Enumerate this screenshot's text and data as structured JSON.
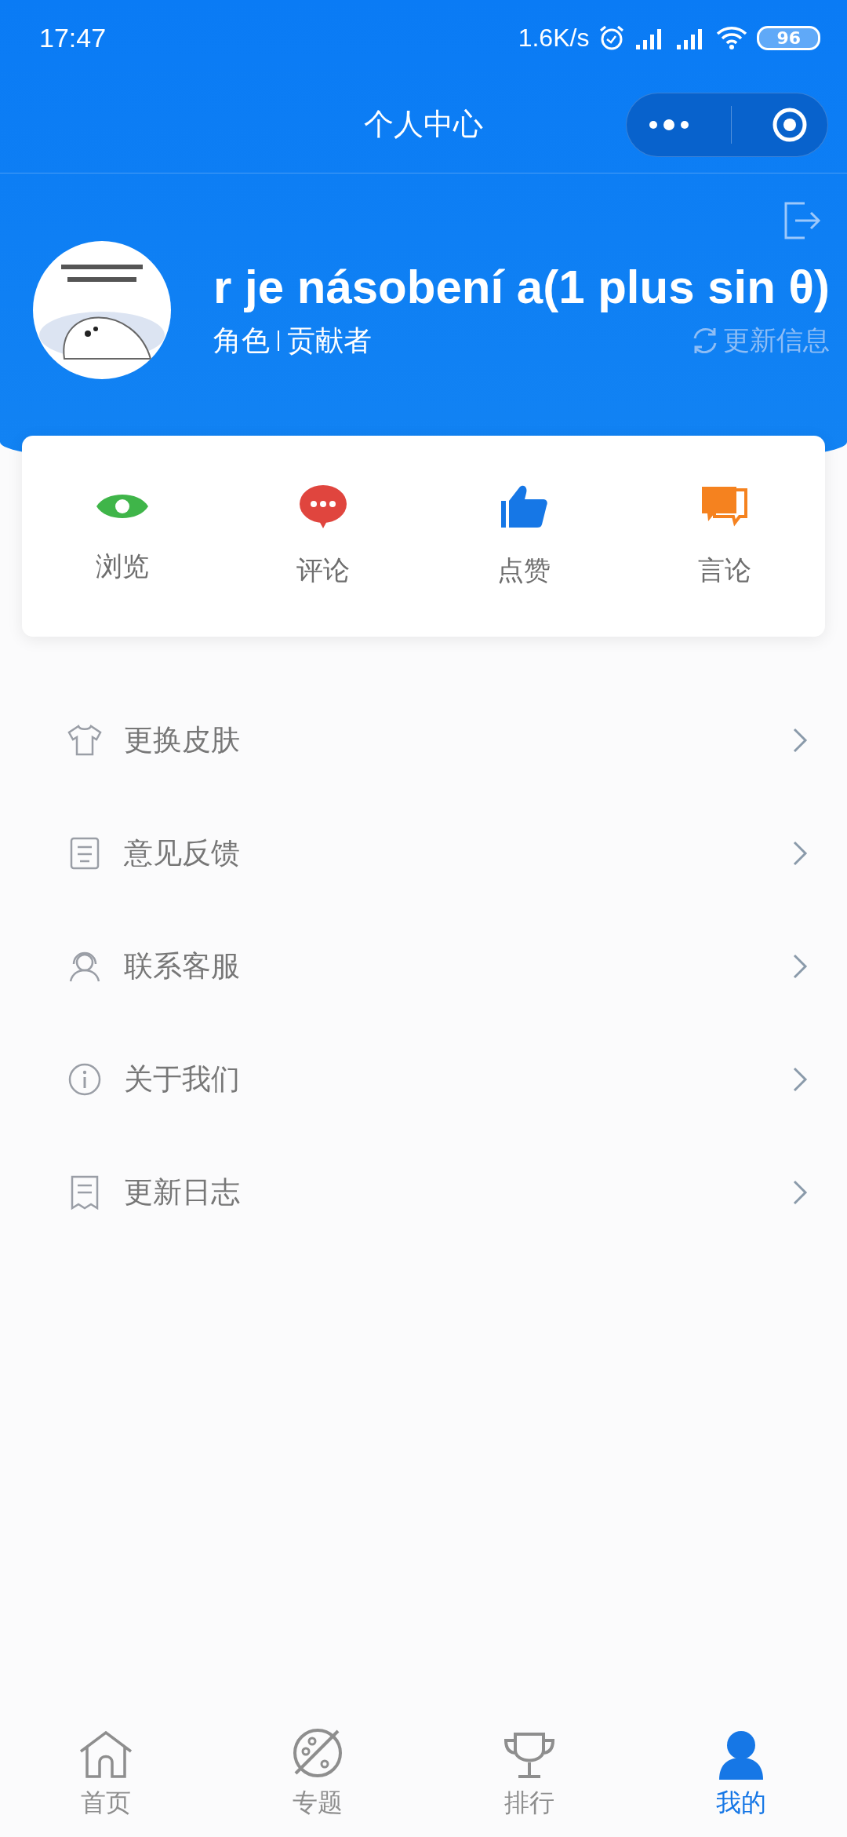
{
  "status_bar": {
    "time": "17:47",
    "net_speed": "1.6K/s",
    "battery": "96"
  },
  "nav": {
    "title": "个人中心"
  },
  "profile": {
    "name": "r je násobení a(1 plus sin θ)",
    "role_label": "角色",
    "role": "贡献者",
    "update_button": "更新信息"
  },
  "stats": [
    {
      "label": "浏览",
      "kind": "eye"
    },
    {
      "label": "评论",
      "kind": "comment"
    },
    {
      "label": "点赞",
      "kind": "like"
    },
    {
      "label": "言论",
      "kind": "speech"
    }
  ],
  "menu": [
    {
      "label": "更换皮肤",
      "kind": "skin"
    },
    {
      "label": "意见反馈",
      "kind": "feedback"
    },
    {
      "label": "联系客服",
      "kind": "service"
    },
    {
      "label": "关于我们",
      "kind": "about"
    },
    {
      "label": "更新日志",
      "kind": "log"
    }
  ],
  "tabs": [
    {
      "label": "首页",
      "kind": "home",
      "selected": false
    },
    {
      "label": "专题",
      "kind": "topic",
      "selected": false
    },
    {
      "label": "排行",
      "kind": "rank",
      "selected": false
    },
    {
      "label": "我的",
      "kind": "mine",
      "selected": true
    }
  ]
}
